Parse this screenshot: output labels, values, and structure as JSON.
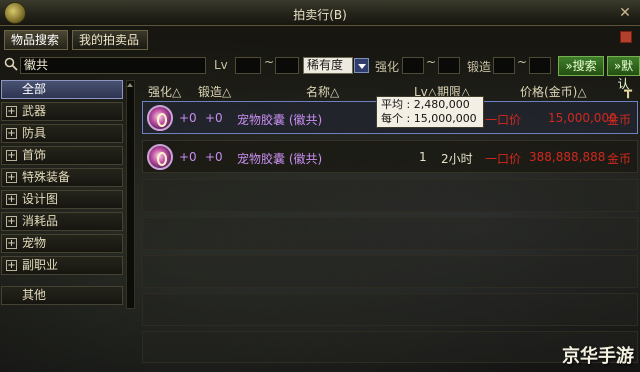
{
  "window": {
    "title": "拍卖行(B)"
  },
  "tabs": [
    {
      "label": "物品搜索",
      "active": true
    },
    {
      "label": "我的拍卖品",
      "active": false
    }
  ],
  "search": {
    "keyword": "徽共",
    "lv_label": "Lv",
    "lv_sep": "~",
    "rarity_value": "稀有度",
    "enhance_label": "强化",
    "enhance_sep": "~",
    "forge_label": "锻造",
    "forge_sep": "~",
    "search_button": "»搜索",
    "reset_button": "»默认"
  },
  "categories": [
    {
      "label": "全部",
      "expandable": false,
      "active": true
    },
    {
      "label": "武器",
      "expandable": true,
      "active": false
    },
    {
      "label": "防具",
      "expandable": true,
      "active": false
    },
    {
      "label": "首饰",
      "expandable": true,
      "active": false
    },
    {
      "label": "特殊装备",
      "expandable": true,
      "active": false
    },
    {
      "label": "设计图",
      "expandable": true,
      "active": false
    },
    {
      "label": "消耗品",
      "expandable": true,
      "active": false
    },
    {
      "label": "宠物",
      "expandable": true,
      "active": false
    },
    {
      "label": "副职业",
      "expandable": true,
      "active": false
    },
    {
      "label": "其他",
      "expandable": false,
      "active": false
    }
  ],
  "table": {
    "headers": {
      "enhance": "强化△",
      "forge": "锻造△",
      "name": "名称△",
      "lv_term": "Lv△期限△",
      "price": "价格(金币)△"
    },
    "rows": [
      {
        "enhance": "+0",
        "forge": "+0",
        "name": "宠物胶囊 (徽共)",
        "lv": "",
        "term": "",
        "buyout": "一口价",
        "price": "15,000,000",
        "currency": "金币",
        "selected": true
      },
      {
        "enhance": "+0",
        "forge": "+0",
        "name": "宠物胶囊 (徽共)",
        "lv": "1",
        "term": "2小时",
        "buyout": "一口价",
        "price": "388,888,888",
        "currency": "金币",
        "selected": false
      }
    ],
    "empty_rows": 5
  },
  "tooltip": {
    "avg_label": "平均 :",
    "avg_value": "2,480,000",
    "each_label": "每个 :",
    "each_value": "15,000,000"
  },
  "watermark": "京华手游",
  "colors": {
    "name_purple": "#c88ef0",
    "price_red": "#d0281e",
    "selected_border": "#6f7fc0"
  }
}
